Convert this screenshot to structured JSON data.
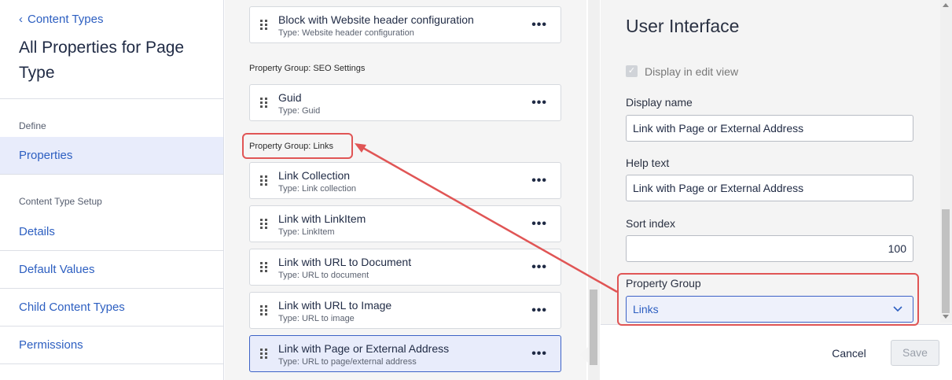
{
  "sidebar": {
    "back_label": "Content Types",
    "title": "All Properties for Page Type",
    "section_define": "Define",
    "section_setup": "Content Type Setup",
    "items": {
      "properties": "Properties",
      "details": "Details",
      "default_values": "Default Values",
      "child_content_types": "Child Content Types",
      "permissions": "Permissions"
    }
  },
  "list": {
    "cards": [
      {
        "title": "Block with Website header configuration",
        "type": "Type: Website header configuration"
      },
      {
        "title": "Guid",
        "type": "Type: Guid"
      },
      {
        "title": "Link Collection",
        "type": "Type: Link collection"
      },
      {
        "title": "Link with LinkItem",
        "type": "Type: LinkItem"
      },
      {
        "title": "Link with URL to Document",
        "type": "Type: URL to document"
      },
      {
        "title": "Link with URL to Image",
        "type": "Type: URL to image"
      },
      {
        "title": "Link with Page or External Address",
        "type": "Type: URL to page/external address"
      }
    ],
    "group_seo": "Property Group: SEO Settings",
    "group_links": "Property Group: Links",
    "more_glyph": "•••"
  },
  "panel": {
    "title": "User Interface",
    "display_in_edit_view": "Display in edit view",
    "display_name_label": "Display name",
    "display_name_value": "Link with Page or External Address",
    "help_text_label": "Help text",
    "help_text_value": "Link with Page or External Address",
    "sort_index_label": "Sort index",
    "sort_index_value": "100",
    "property_group_label": "Property Group",
    "property_group_value": "Links",
    "cancel": "Cancel",
    "save": "Save"
  },
  "colors": {
    "link": "#2d5fc1",
    "active_bg": "#e8ecfb",
    "annotation": "#e05555"
  }
}
